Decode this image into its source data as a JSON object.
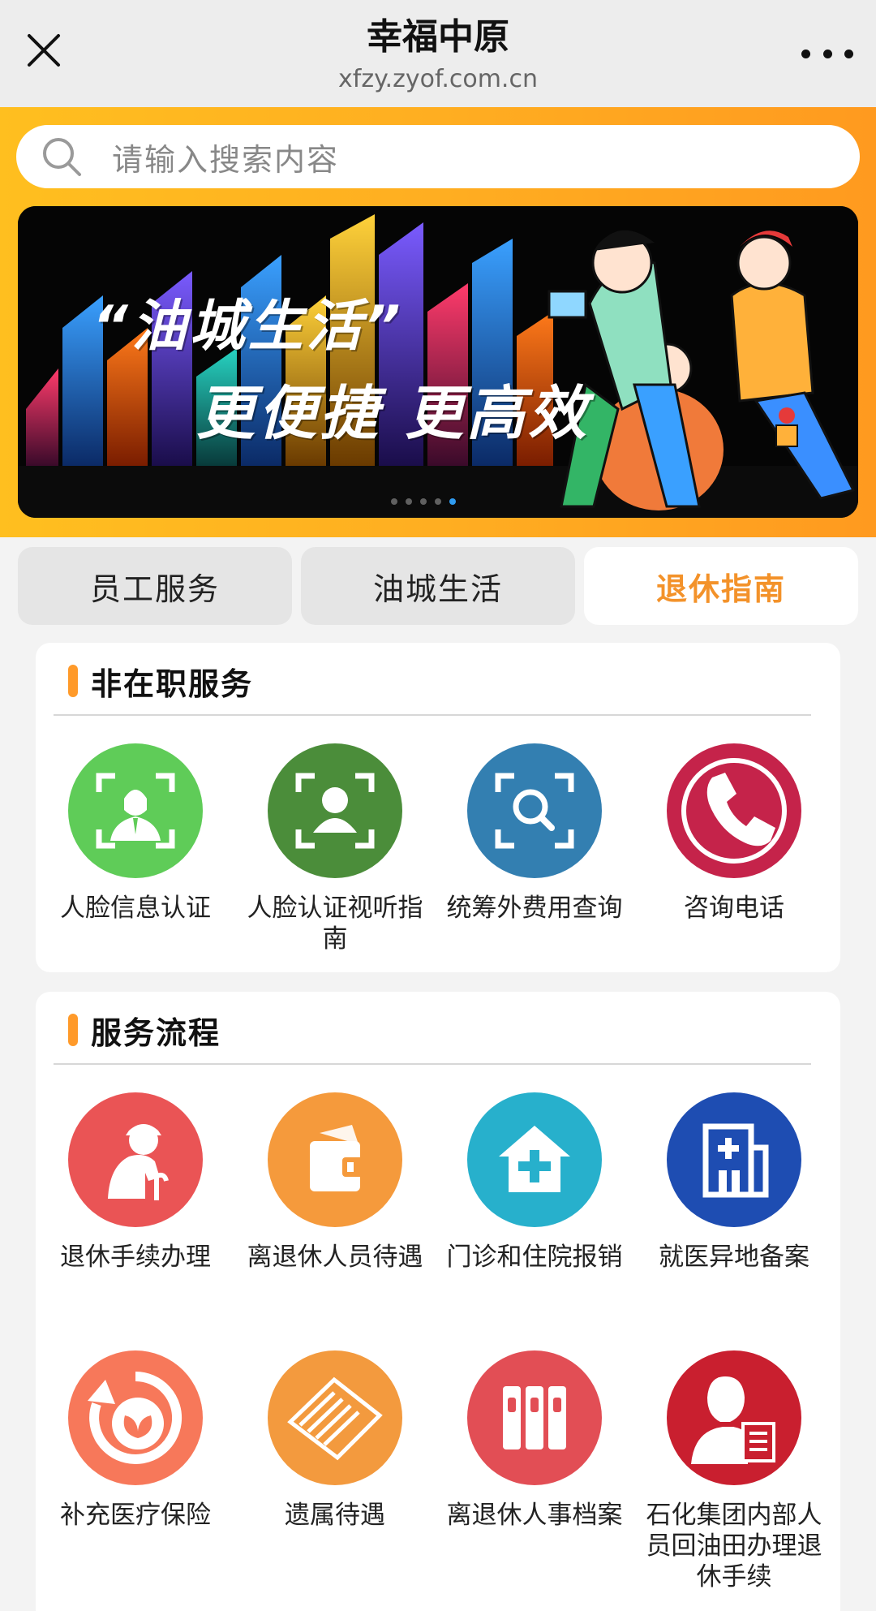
{
  "nav": {
    "title": "幸福中原",
    "url": "xfzy.zyof.com.cn"
  },
  "search": {
    "placeholder": "请输入搜索内容"
  },
  "banner": {
    "line1": "“油城生活”",
    "line2": "更便捷 更高效",
    "slide_count": 5,
    "active_slide": 4
  },
  "tabs": [
    {
      "label": "员工服务",
      "active": false
    },
    {
      "label": "油城生活",
      "active": false
    },
    {
      "label": "退休指南",
      "active": true
    }
  ],
  "sections": [
    {
      "title": "非在职服务",
      "items": [
        {
          "label": "人脸信息认证",
          "icon": "face-verify-icon",
          "color": "#5fcc58"
        },
        {
          "label": "人脸认证视听指南",
          "icon": "face-scan-user-icon",
          "color": "#4b8d3a"
        },
        {
          "label": "统筹外费用查询",
          "icon": "scan-search-icon",
          "color": "#337fb1"
        },
        {
          "label": "咨询电话",
          "icon": "phone-icon",
          "color": "#c5234a"
        }
      ]
    },
    {
      "title": "服务流程",
      "items": [
        {
          "label": "退休手续办理",
          "icon": "elderly-person-icon",
          "color": "#ea5455"
        },
        {
          "label": "离退休人员待遇",
          "icon": "wallet-icon",
          "color": "#f59a3c"
        },
        {
          "label": "门诊和住院报销",
          "icon": "hospital-house-icon",
          "color": "#27b0cc"
        },
        {
          "label": "就医异地备案",
          "icon": "hospital-building-icon",
          "color": "#1e4db2"
        },
        {
          "label": "补充医疗保险",
          "icon": "leaf-refresh-icon",
          "color": "#f7785a"
        },
        {
          "label": "遗属待遇",
          "icon": "documents-icon",
          "color": "#f39a3e"
        },
        {
          "label": "离退休人事档案",
          "icon": "archive-binders-icon",
          "color": "#e24e55"
        },
        {
          "label": "石化集团内部人员回油田办理退休手续",
          "icon": "person-document-icon",
          "color": "#c91f2f"
        }
      ]
    }
  ]
}
